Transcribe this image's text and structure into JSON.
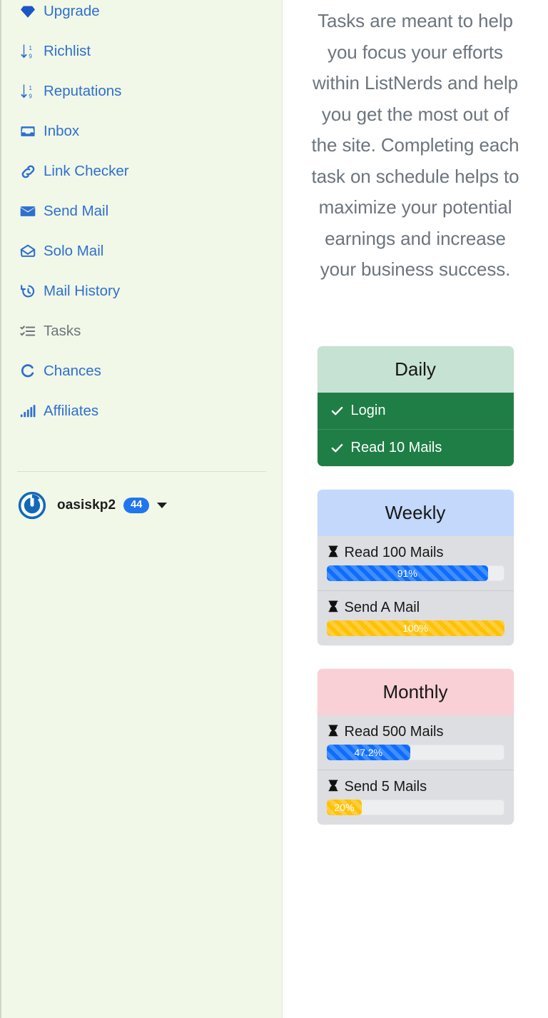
{
  "sidebar": {
    "nav_items": [
      {
        "label": "Upgrade",
        "icon": "gem-icon",
        "state": "link",
        "cut_off": true
      },
      {
        "label": "Richlist",
        "icon": "sort-down-19-icon",
        "state": "link"
      },
      {
        "label": "Reputations",
        "icon": "sort-down-19-icon",
        "state": "link"
      },
      {
        "label": "Inbox",
        "icon": "inbox-icon",
        "state": "link"
      },
      {
        "label": "Link Checker",
        "icon": "link-icon",
        "state": "link"
      },
      {
        "label": "Send Mail",
        "icon": "envelope-icon",
        "state": "link"
      },
      {
        "label": "Solo Mail",
        "icon": "envelope-open-icon",
        "state": "link"
      },
      {
        "label": "Mail History",
        "icon": "clock-history-icon",
        "state": "link"
      },
      {
        "label": "Tasks",
        "icon": "checklist-icon",
        "state": "active"
      },
      {
        "label": "Chances",
        "icon": "arrow-clockwise-c-icon",
        "state": "link"
      },
      {
        "label": "Affiliates",
        "icon": "bar-chart-icon",
        "state": "link"
      }
    ],
    "user": {
      "avatar_icon": "power-circle-avatar",
      "name": "oasiskp2",
      "badge": "44",
      "caret_icon": "caret-down-icon"
    },
    "colors": {
      "background": "#f1f8e7",
      "link": "#2f6fd0",
      "muted": "#6c757d",
      "badge": "#2176ee"
    }
  },
  "main": {
    "intro": "Tasks are meant to help you focus your efforts within ListNerds and help you get the most out of the site. Completing each task on schedule helps to maximize your potential earnings and increase your business success.",
    "cards": [
      {
        "title": "Daily",
        "header_color": "#c6e2d3",
        "tasks": [
          {
            "label": "Login",
            "status": "complete",
            "icon": "check-icon"
          },
          {
            "label": "Read 10 Mails",
            "status": "complete",
            "icon": "check-icon"
          }
        ]
      },
      {
        "title": "Weekly",
        "header_color": "#c3d8fb",
        "tasks": [
          {
            "label": "Read 100 Mails",
            "status": "pending",
            "icon": "hourglass-icon",
            "percent": 91,
            "percent_label": "91%",
            "bar_color": "#0d6efd"
          },
          {
            "label": "Send A Mail",
            "status": "pending",
            "icon": "hourglass-icon",
            "percent": 100,
            "percent_label": "100%",
            "bar_color": "#ffc107"
          }
        ]
      },
      {
        "title": "Monthly",
        "header_color": "#f8d0d5",
        "tasks": [
          {
            "label": "Read 500 Mails",
            "status": "pending",
            "icon": "hourglass-icon",
            "percent": 47.2,
            "percent_label": "47.2%",
            "bar_color": "#0d6efd"
          },
          {
            "label": "Send 5 Mails",
            "status": "pending",
            "icon": "hourglass-icon",
            "percent": 20,
            "percent_label": "20%",
            "bar_color": "#ffc107"
          }
        ]
      }
    ]
  }
}
